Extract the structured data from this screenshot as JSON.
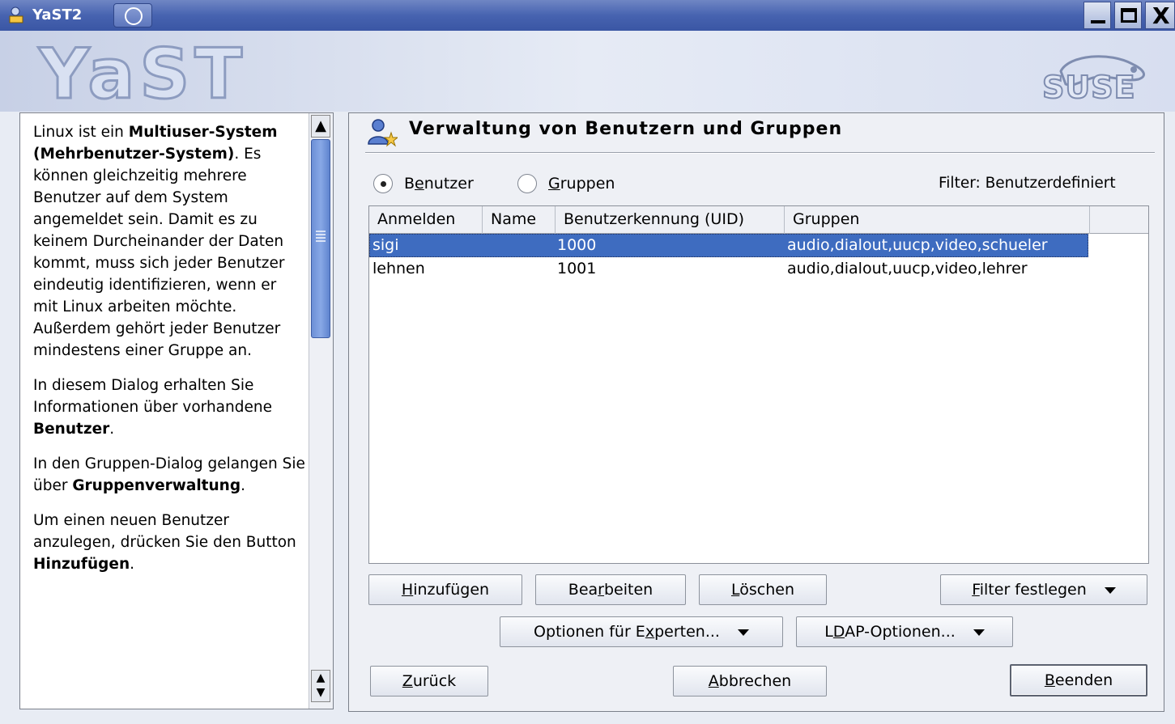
{
  "window": {
    "title": "YaST2",
    "icons": [
      "yast-app-icon",
      "suse-swirl-icon",
      "minimize-icon",
      "maximize-icon",
      "close-icon"
    ],
    "close_glyph": "X"
  },
  "header": {
    "logo_text": "YaST",
    "brand_text": "SUSE"
  },
  "help": {
    "p1_a": "Linux ist ein ",
    "p1_b": "Multiuser-System (Mehrbenutzer-System)",
    "p1_c": ". Es können gleichzeitig mehrere Benutzer auf dem System angemeldet sein. Damit es zu keinem Durcheinander der Daten kommt, muss sich jeder Benutzer eindeutig identifizieren, wenn er mit Linux arbeiten möchte. Außerdem gehört jeder Benutzer mindestens einer Gruppe an.",
    "p2_a": "In diesem Dialog erhalten Sie Informationen über vorhandene ",
    "p2_b": "Benutzer",
    "p2_c": ".",
    "p3_a": "In den Gruppen-Dialog gelangen Sie über ",
    "p3_b": "Gruppenverwaltung",
    "p3_c": ".",
    "p4_a": "Um einen neuen Benutzer anzulegen, drücken Sie den Button ",
    "p4_b": "Hinzufügen",
    "p4_c": "."
  },
  "main": {
    "title": "Verwaltung von Benutzern und Gruppen",
    "radio_users": {
      "pre": "B",
      "key": "e",
      "post": "nutzer",
      "selected": true
    },
    "radio_groups": {
      "pre": "",
      "key": "G",
      "post": "ruppen",
      "selected": false
    },
    "filter_text": "Filter: Benutzerdefiniert",
    "columns": [
      "Anmelden",
      "Name",
      "Benutzerkennung (UID)",
      "Gruppen"
    ],
    "rows": [
      {
        "login": "sigi",
        "name": "",
        "uid": "1000",
        "groups": "audio,dialout,uucp,video,schueler",
        "selected": true
      },
      {
        "login": "lehnen",
        "name": "",
        "uid": "1001",
        "groups": "audio,dialout,uucp,video,lehrer",
        "selected": false
      }
    ]
  },
  "buttons": {
    "add": {
      "pre": "",
      "key": "H",
      "post": "inzufügen"
    },
    "edit": {
      "pre": "Bea",
      "key": "r",
      "post": "beiten"
    },
    "delete": {
      "pre": "",
      "key": "L",
      "post": "öschen"
    },
    "filter": {
      "pre": "",
      "key": "F",
      "post": "ilter festlegen"
    },
    "expert": {
      "pre": "Optionen für E",
      "key": "x",
      "post": "perten..."
    },
    "ldap": {
      "pre": "L",
      "key": "D",
      "post": "AP-Optionen..."
    },
    "back": {
      "pre": "",
      "key": "Z",
      "post": "urück"
    },
    "abort": {
      "pre": "",
      "key": "A",
      "post": "bbrechen"
    },
    "finish": {
      "pre": "",
      "key": "B",
      "post": "eenden"
    }
  }
}
